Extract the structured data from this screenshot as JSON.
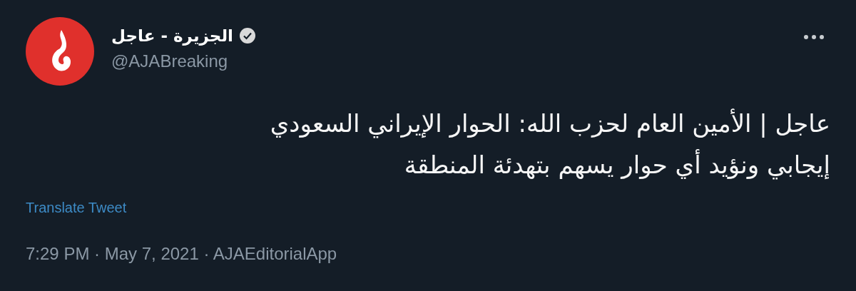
{
  "tweet": {
    "author": {
      "name": "الجزيرة - عاجل",
      "verified": true,
      "handle": "@AJABreaking"
    },
    "text": "عاجل | الأمين العام لحزب الله: الحوار الإيراني السعودي\nإيجابي ونؤيد أي حوار يسهم بتهدئة المنطقة",
    "translate_link": "Translate Tweet",
    "meta": "7:29 PM · May 7, 2021 · AJAEditorialApp"
  }
}
